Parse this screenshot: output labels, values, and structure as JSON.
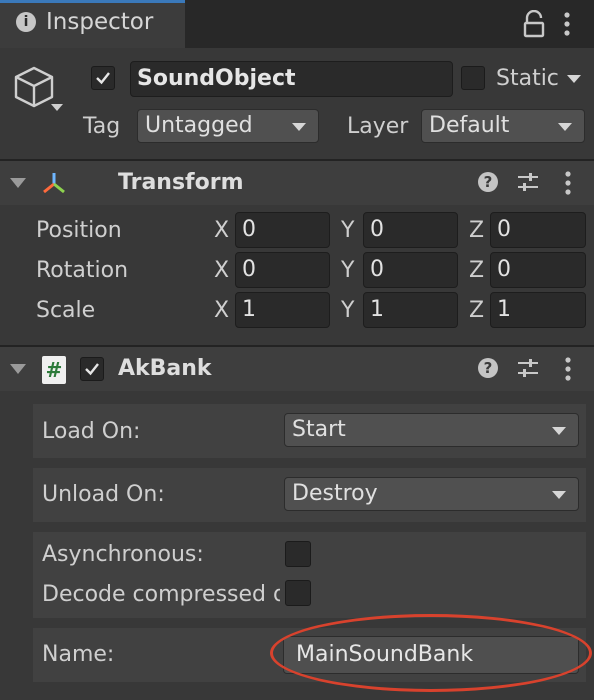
{
  "window": {
    "tab_title": "Inspector",
    "tab_icon": "info-icon"
  },
  "gameobject": {
    "active": true,
    "name": "SoundObject",
    "static_label": "Static",
    "static_checked": false,
    "tag_label": "Tag",
    "tag_value": "Untagged",
    "layer_label": "Layer",
    "layer_value": "Default"
  },
  "transform": {
    "title": "Transform",
    "rows": [
      {
        "label": "Position",
        "x": "0",
        "y": "0",
        "z": "0"
      },
      {
        "label": "Rotation",
        "x": "0",
        "y": "0",
        "z": "0"
      },
      {
        "label": "Scale",
        "x": "1",
        "y": "1",
        "z": "1"
      }
    ],
    "axis": {
      "x": "X",
      "y": "Y",
      "z": "Z"
    }
  },
  "akbank": {
    "title": "AkBank",
    "enabled": true,
    "script_icon_glyph": "#",
    "load_on": {
      "label": "Load On:",
      "value": "Start"
    },
    "unload_on": {
      "label": "Unload On:",
      "value": "Destroy"
    },
    "asynchronous": {
      "label": "Asynchronous:",
      "checked": false
    },
    "decode_compressed": {
      "label": "Decode compressed d",
      "checked": false
    },
    "name_field": {
      "label": "Name:",
      "value": "MainSoundBank"
    }
  },
  "colors": {
    "accent": "#3a79bb",
    "highlight_ring": "#d8422d",
    "background": "#383838"
  }
}
